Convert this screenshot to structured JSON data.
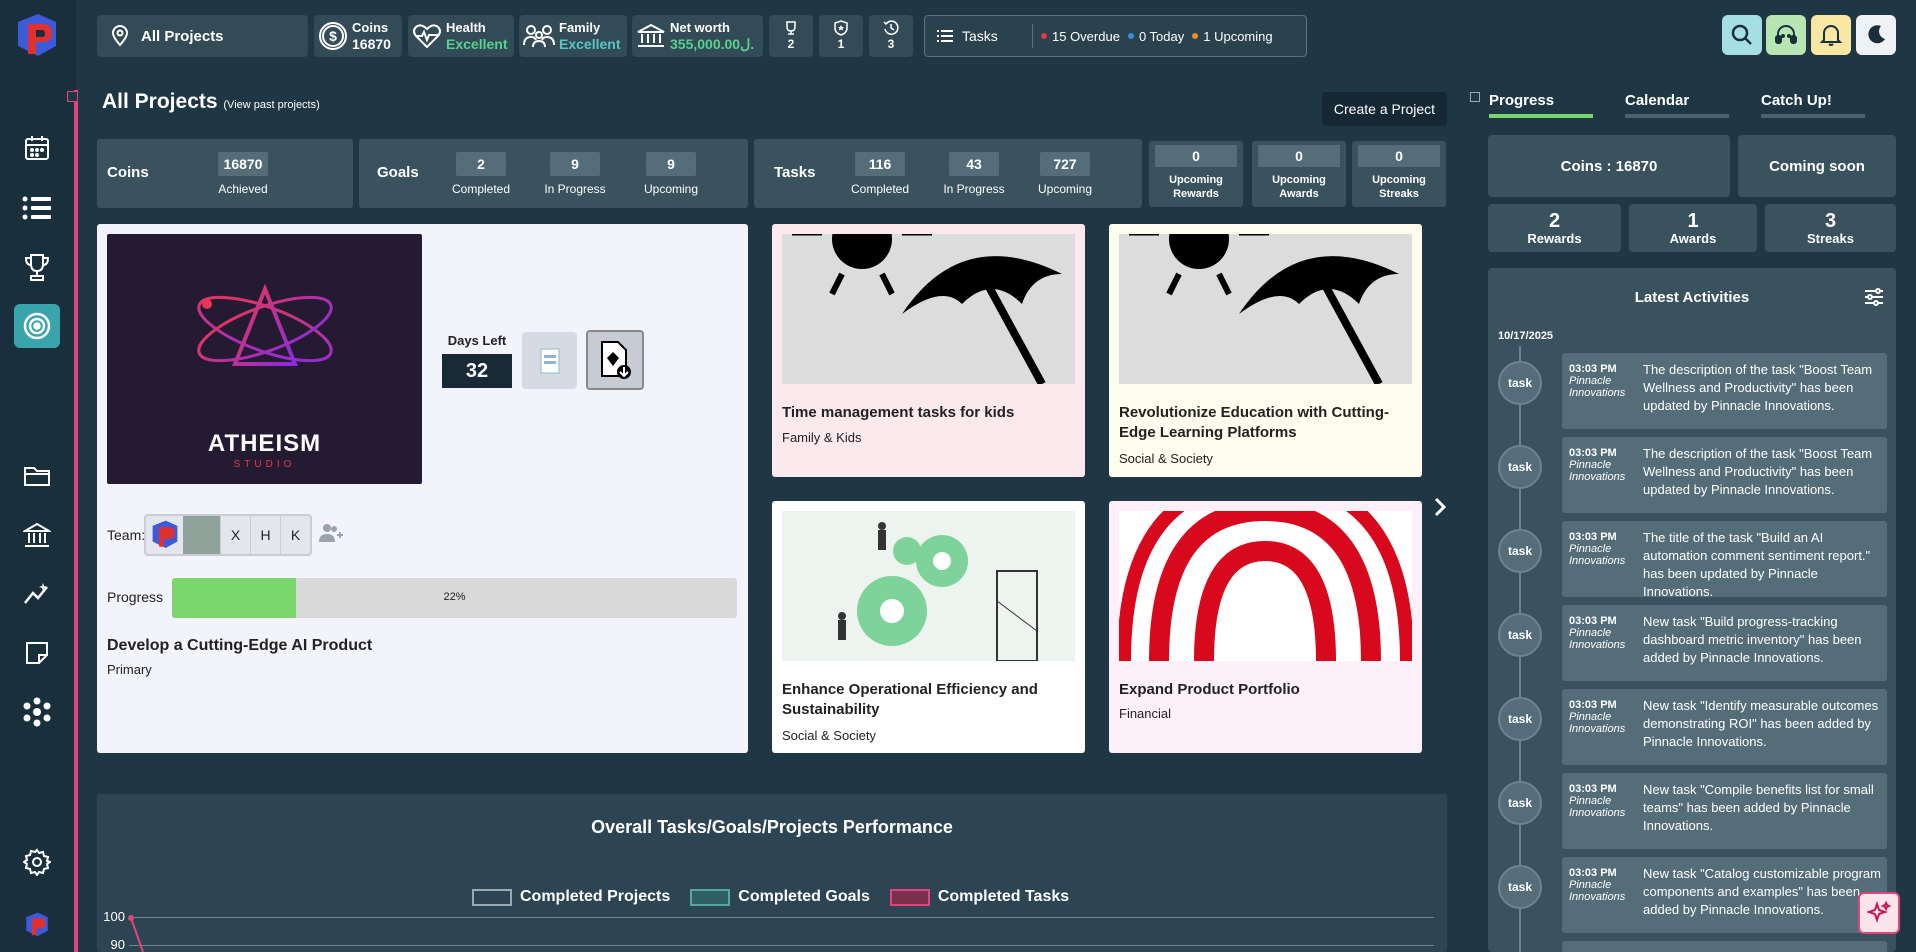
{
  "topbar": {
    "projects_label": "All Projects",
    "coins_label": "Coins",
    "coins_value": "16870",
    "health_label": "Health",
    "health_value": "Excellent",
    "family_label": "Family",
    "family_value": "Excellent",
    "networth_label": "Net worth",
    "networth_value": "355,000.00ل.",
    "trophy_count": "2",
    "shield_count": "1",
    "streak_count": "3",
    "tasks_label": "Tasks",
    "overdue": "15 Overdue",
    "today": "0 Today",
    "upcoming": "1 Upcoming"
  },
  "main": {
    "title": "All Projects",
    "subtitle": "(View past projects)",
    "create_button": "Create a Project"
  },
  "stats": {
    "coins": {
      "label": "Coins",
      "value": "16870",
      "caption": "Achieved"
    },
    "goals": {
      "label": "Goals",
      "completed": "2",
      "in_progress": "9",
      "upcoming": "9"
    },
    "tasks": {
      "label": "Tasks",
      "completed": "116",
      "in_progress": "43",
      "upcoming": "727"
    },
    "captions": {
      "completed": "Completed",
      "in_progress": "In Progress",
      "upcoming": "Upcoming"
    },
    "upcoming_rewards": {
      "value": "0",
      "line1": "Upcoming",
      "line2": "Rewards"
    },
    "upcoming_awards": {
      "value": "0",
      "line1": "Upcoming",
      "line2": "Awards"
    },
    "upcoming_streaks": {
      "value": "0",
      "line1": "Upcoming",
      "line2": "Streaks"
    }
  },
  "featured": {
    "logo_text": "ATHEISM",
    "logo_sub": "STUDIO",
    "days_left_label": "Days Left",
    "days_left_value": "32",
    "team_label": "Team:",
    "team_members": [
      "X",
      "H",
      "K"
    ],
    "progress_label": "Progress",
    "progress_value": 0.22,
    "progress_text": "22%",
    "title": "Develop a Cutting-Edge AI Product",
    "category": "Primary"
  },
  "cards": [
    {
      "title": "Time management tasks for kids",
      "category": "Family & Kids"
    },
    {
      "title": "Revolutionize Education with Cutting-Edge Learning Platforms",
      "category": "Social & Society"
    },
    {
      "title": "Enhance Operational Efficiency and Sustainability",
      "category": "Social & Society"
    },
    {
      "title": "Expand Product Portfolio",
      "category": "Financial"
    }
  ],
  "right": {
    "tabs": [
      "Progress",
      "Calendar",
      "Catch Up!"
    ],
    "coins_box": "Coins : 16870",
    "coming_soon": "Coming soon",
    "rewards": {
      "value": "2",
      "label": "Rewards"
    },
    "awards": {
      "value": "1",
      "label": "Awards"
    },
    "streaks": {
      "value": "3",
      "label": "Streaks"
    },
    "activities_title": "Latest Activities",
    "date": "10/17/2025",
    "activities": [
      {
        "tag": "task",
        "time": "03:03 PM",
        "org": "Pinnacle Innovations",
        "text": "The description of the task \"Boost Team Wellness and Productivity\" has been updated by Pinnacle Innovations."
      },
      {
        "tag": "task",
        "time": "03:03 PM",
        "org": "Pinnacle Innovations",
        "text": "The description of the task \"Boost Team Wellness and Productivity\" has been updated by Pinnacle Innovations."
      },
      {
        "tag": "task",
        "time": "03:03 PM",
        "org": "Pinnacle Innovations",
        "text": "The title of the task \"Build an AI automation comment sentiment report.\" has been updated by Pinnacle Innovations."
      },
      {
        "tag": "task",
        "time": "03:03 PM",
        "org": "Pinnacle Innovations",
        "text": "New task \"Build progress-tracking dashboard metric inventory\" has been added by Pinnacle Innovations."
      },
      {
        "tag": "task",
        "time": "03:03 PM",
        "org": "Pinnacle Innovations",
        "text": "New task \"Identify measurable outcomes demonstrating ROI\" has been added by Pinnacle Innovations."
      },
      {
        "tag": "task",
        "time": "03:03 PM",
        "org": "Pinnacle Innovations",
        "text": "New task \"Compile benefits list for small teams\" has been added by Pinnacle Innovations."
      },
      {
        "tag": "task",
        "time": "03:03 PM",
        "org": "Pinnacle Innovations",
        "text": "New task \"Catalog customizable program components and examples\" has been added by Pinnacle Innovations."
      }
    ]
  },
  "chart": {
    "title": "Overall Tasks/Goals/Projects Performance",
    "legend": [
      "Completed Projects",
      "Completed Goals",
      "Completed Tasks"
    ],
    "colors": [
      "#2d4553",
      "#56a7a0",
      "#e0457b"
    ],
    "ticks": [
      "100",
      "90"
    ]
  }
}
